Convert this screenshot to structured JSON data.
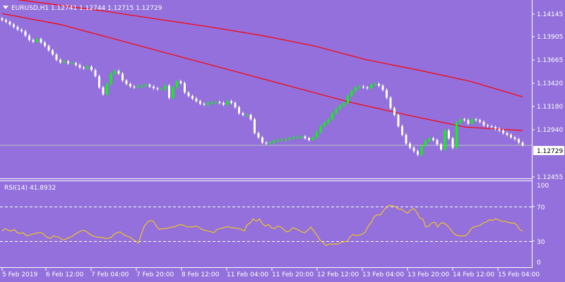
{
  "header": {
    "symbol_line": "EURUSD,H1  1.12741 1.12744 1.12715 1.12729"
  },
  "price_pane": {
    "current_price_label": "1.12729",
    "current_price": 1.12729,
    "y_ticks": [
      "1.14145",
      "1.13905",
      "1.13665",
      "1.13420",
      "1.13180",
      "1.12940",
      "1.12700",
      "1.12455"
    ],
    "ylim": [
      1.1237,
      1.1438
    ]
  },
  "rsi_pane": {
    "label": "RSI(14) 41.8932",
    "y_ticks": [
      "100",
      "70",
      "30",
      "0"
    ],
    "ylim": [
      0,
      100
    ],
    "levels": [
      70,
      30
    ]
  },
  "time_axis": {
    "labels": [
      "5 Feb 2019",
      "6 Feb 12:00",
      "7 Feb 04:00",
      "7 Feb 20:00",
      "8 Feb 12:00",
      "11 Feb 04:00",
      "11 Feb 20:00",
      "12 Feb 12:00",
      "13 Feb 04:00",
      "13 Feb 20:00",
      "14 Feb 12:00",
      "15 Feb 04:00"
    ]
  },
  "colors": {
    "background": "#9370db",
    "bull_candle": "#00ff00",
    "bear_candle": "#ffffff",
    "moving_average": "#ff0000",
    "rsi_line": "#ffd700",
    "grid_line": "#ffffff"
  },
  "chart_data": {
    "type": "candlestick",
    "symbol": "EURUSD",
    "timeframe": "H1",
    "closes": [
      1.1418,
      1.1416,
      1.1413,
      1.141,
      1.1407,
      1.1405,
      1.14,
      1.1395,
      1.1393,
      1.1396,
      1.1392,
      1.1388,
      1.1383,
      1.1378,
      1.1372,
      1.1369,
      1.137,
      1.1368,
      1.1368,
      1.1366,
      1.1363,
      1.1362,
      1.1364,
      1.136,
      1.1353,
      1.134,
      1.1332,
      1.1344,
      1.1356,
      1.1359,
      1.1356,
      1.1348,
      1.1344,
      1.1341,
      1.134,
      1.1341,
      1.1342,
      1.1343,
      1.1341,
      1.1339,
      1.1338,
      1.1338,
      1.1342,
      1.1328,
      1.134,
      1.1347,
      1.1345,
      1.1334,
      1.133,
      1.1327,
      1.1324,
      1.1321,
      1.132,
      1.1322,
      1.1322,
      1.1323,
      1.1322,
      1.132,
      1.1324,
      1.1322,
      1.1317,
      1.131,
      1.1308,
      1.1308,
      1.1303,
      1.1287,
      1.1282,
      1.1276,
      1.1275,
      1.1276,
      1.1278,
      1.1279,
      1.1279,
      1.128,
      1.1281,
      1.1282,
      1.1282,
      1.1283,
      1.1281,
      1.1279,
      1.1282,
      1.1288,
      1.1295,
      1.1299,
      1.1303,
      1.131,
      1.1315,
      1.1319,
      1.1322,
      1.133,
      1.1336,
      1.134,
      1.1341,
      1.134,
      1.1339,
      1.1343,
      1.1344,
      1.1342,
      1.1337,
      1.1328,
      1.1316,
      1.1308,
      1.1295,
      1.1285,
      1.1275,
      1.127,
      1.1266,
      1.1262,
      1.1272,
      1.1278,
      1.1281,
      1.1279,
      1.1274,
      1.1268,
      1.129,
      1.1281,
      1.127,
      1.1299,
      1.1303,
      1.1302,
      1.1298,
      1.1303,
      1.1302,
      1.13,
      1.1296,
      1.1295,
      1.1294,
      1.1292,
      1.129,
      1.1287,
      1.1285,
      1.1282,
      1.128,
      1.1276,
      1.1273
    ],
    "rsi": [
      42,
      45,
      43,
      42,
      44,
      40,
      39,
      40,
      36,
      37,
      38,
      39,
      40,
      40,
      37,
      34,
      33,
      36,
      35,
      34,
      31,
      32,
      34,
      35,
      38,
      40,
      42,
      43,
      41,
      38,
      36,
      35,
      34,
      34,
      33,
      33,
      34,
      38,
      40,
      41,
      38,
      36,
      35,
      32,
      30,
      27,
      38,
      48,
      53,
      55,
      54,
      48,
      44,
      45,
      45,
      46,
      47,
      47,
      49,
      50,
      49,
      47,
      47,
      47,
      48,
      47,
      44,
      43,
      42,
      41,
      40,
      44,
      45,
      46,
      47,
      47,
      46,
      46,
      45,
      44,
      42,
      50,
      52,
      57,
      54,
      57,
      51,
      48,
      50,
      46,
      45,
      48,
      47,
      44,
      41,
      42,
      46,
      45,
      43,
      41,
      40,
      43,
      47,
      42,
      37,
      31,
      28,
      24,
      26,
      26,
      26,
      26,
      28,
      29,
      29,
      35,
      38,
      36,
      37,
      38,
      41,
      48,
      53,
      60,
      62,
      62,
      67,
      71,
      74,
      73,
      72,
      69,
      69,
      66,
      64,
      68,
      70,
      65,
      58,
      57,
      47,
      48,
      52,
      53,
      47,
      52,
      52,
      49,
      45,
      40,
      37,
      36,
      36,
      36,
      39,
      45,
      47,
      48,
      49,
      52,
      53,
      56,
      55,
      57,
      56,
      54,
      54,
      53,
      52,
      52,
      50,
      44,
      42
    ],
    "moving_averages": [
      {
        "values": [
          1.14255,
          1.1413,
          1.1395,
          1.1377,
          1.1359,
          1.1341,
          1.1323,
          1.1308,
          1.1294,
          1.129
        ]
      },
      {
        "values": [
          1.1444,
          1.1436,
          1.1428,
          1.1419,
          1.141,
          1.14,
          1.1388,
          1.1372,
          1.136,
          1.1347,
          1.1329
        ]
      }
    ]
  }
}
